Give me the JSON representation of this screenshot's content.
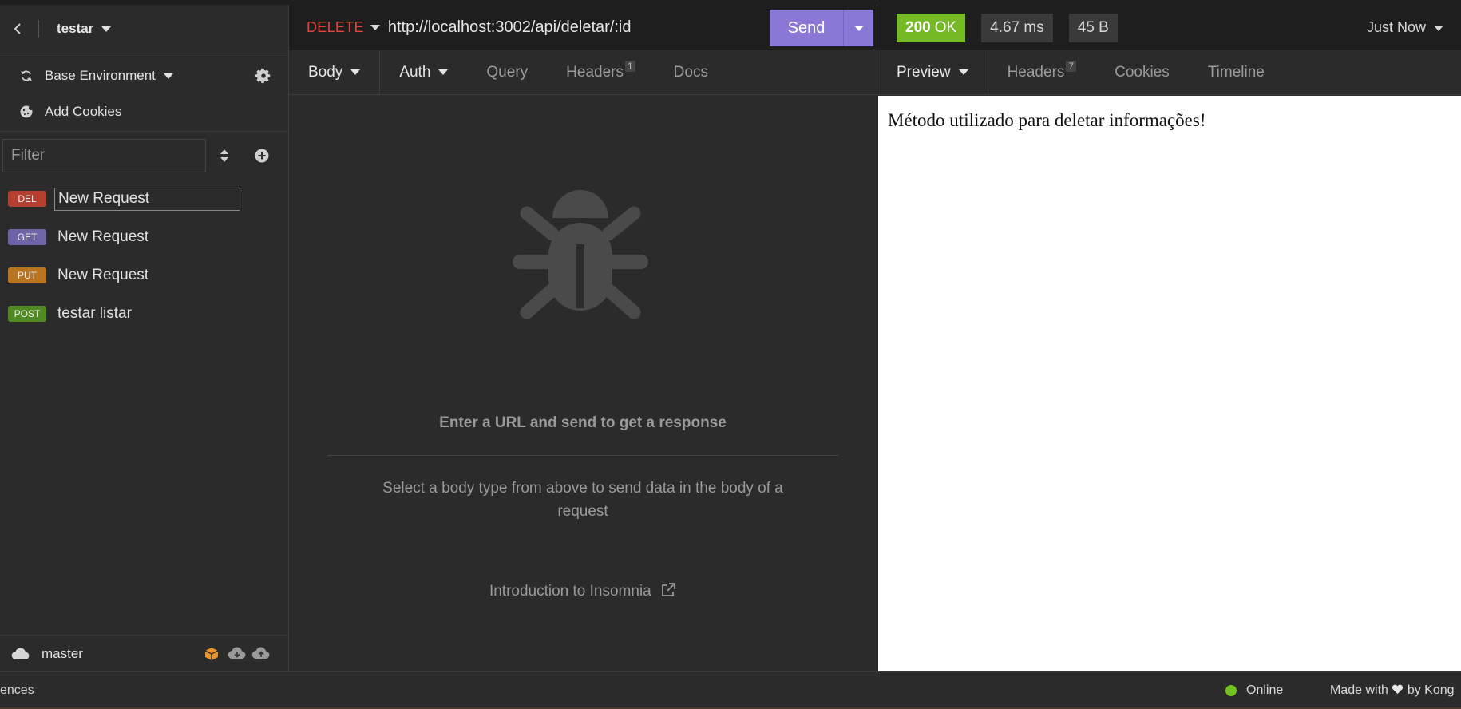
{
  "workspace": {
    "name": "testar"
  },
  "sidebar": {
    "environment": "Base Environment",
    "add_cookies": "Add Cookies",
    "filter_placeholder": "Filter",
    "requests": [
      {
        "method_badge": "DEL",
        "name": "New Request",
        "color": "#b5402f"
      },
      {
        "method_badge": "GET",
        "name": "New Request",
        "color": "#6f64a8"
      },
      {
        "method_badge": "PUT",
        "name": "New Request",
        "color": "#b97422"
      },
      {
        "method_badge": "POST",
        "name": "testar listar",
        "color": "#4f8a22"
      }
    ],
    "branch": "master"
  },
  "request": {
    "method": "DELETE",
    "url": "http://localhost:3002/api/deletar/:id",
    "send_label": "Send",
    "tabs": [
      {
        "label": "Body"
      },
      {
        "label": "Auth"
      },
      {
        "label": "Query"
      },
      {
        "label": "Headers",
        "count": "1"
      },
      {
        "label": "Docs"
      }
    ],
    "empty_title": "Enter a URL and send to get a response",
    "empty_desc": "Select a body type from above to send data in the body of a request",
    "intro_link": "Introduction to Insomnia"
  },
  "response": {
    "status_code": "200",
    "status_text": "OK",
    "time": "4.67 ms",
    "size": "45 B",
    "when": "Just Now",
    "tabs": [
      {
        "label": "Preview"
      },
      {
        "label": "Headers",
        "count": "7"
      },
      {
        "label": "Cookies"
      },
      {
        "label": "Timeline"
      }
    ],
    "body": "Método utilizado para deletar informações!"
  },
  "statusbar": {
    "left_text": "ences",
    "online": "Online",
    "made_with_prefix": "Made with",
    "made_with_suffix": "by Kong"
  },
  "colors": {
    "send": "#8a78d6",
    "status_ok": "#75ba24",
    "method_delete": "#e1453a",
    "online_dot": "#71c21c"
  }
}
